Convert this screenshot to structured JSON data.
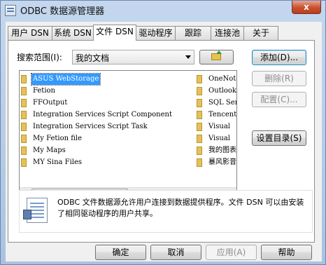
{
  "window": {
    "title": "ODBC 数据源管理器",
    "close": "x"
  },
  "tabs": [
    "用户 DSN",
    "系统 DSN",
    "文件 DSN",
    "驱动程序",
    "跟踪",
    "连接池",
    "关于"
  ],
  "lookin": {
    "label": "搜索范围(I):",
    "value": "我的文档"
  },
  "files": {
    "column1": [
      "ASUS WebStorage",
      "Fetion",
      "FFOutput",
      "Integration Services Script Component",
      "Integration Services Script Task",
      "My Fetion file",
      "My Maps",
      "MY Sina Files"
    ],
    "column2": [
      "OneNote",
      "Outlook",
      "SQL Ser",
      "Tencent",
      "Visual",
      "Visual",
      "我的图表",
      "暴风影音"
    ],
    "scroll_grip": "III"
  },
  "actions": {
    "add": "添加(D)...",
    "remove": "删除(R)",
    "configure": "配置(C)...",
    "set_dir": "设置目录(S)"
  },
  "description": "ODBC 文件数据源允许用户连接到数据提供程序。文件 DSN 可以由安装了相同驱动程序的用户共享。",
  "footer": {
    "ok": "确定",
    "cancel": "取消",
    "apply": "应用(A)",
    "help": "帮助"
  }
}
